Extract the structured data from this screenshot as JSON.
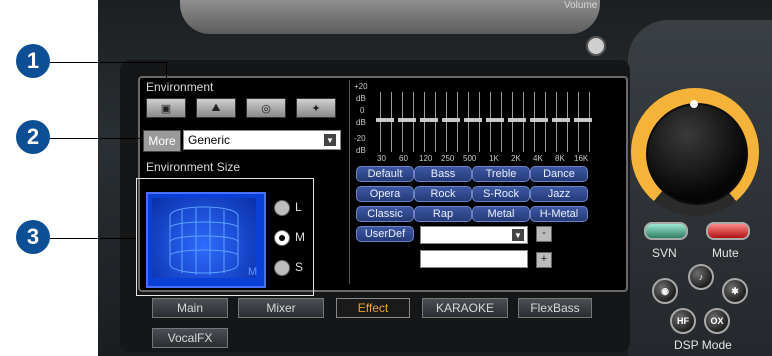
{
  "top": {
    "volume_label": "Volume"
  },
  "environment": {
    "title": "Environment",
    "buttons": [
      "stage-icon",
      "mountain-icon",
      "cave-icon",
      "hall-icon"
    ],
    "more_label": "More",
    "selected": "Generic"
  },
  "environment_size": {
    "title": "Environment Size",
    "options": [
      "L",
      "M",
      "S"
    ],
    "selected": "M",
    "badge": "M"
  },
  "equalizer": {
    "scale": [
      "+20",
      "dB",
      "0",
      "dB",
      "-20",
      "dB"
    ],
    "bands": [
      "30",
      "60",
      "120",
      "250",
      "500",
      "1K",
      "2K",
      "4K",
      "8K",
      "16K"
    ],
    "presets": [
      [
        "Default",
        "Bass",
        "Treble",
        "Dance"
      ],
      [
        "Opera",
        "Rock",
        "S-Rock",
        "Jazz"
      ],
      [
        "Classic",
        "Rap",
        "Metal",
        "H-Metal"
      ],
      [
        "UserDef"
      ]
    ],
    "minus": "-",
    "plus": "+"
  },
  "tabs": [
    "Main",
    "Mixer",
    "Effect",
    "KARAOKE",
    "FlexBass",
    "VocalFX"
  ],
  "active_tab": "Effect",
  "right": {
    "svn_label": "SVN",
    "mute_label": "Mute",
    "dsp_mode_label": "DSP Mode",
    "dsp_buttons": [
      "HF",
      "OX"
    ]
  },
  "callouts": [
    "1",
    "2",
    "3"
  ],
  "colors": {
    "accent": "#f2a12b",
    "preset_bg": "#2f4a94",
    "callout": "#0c4f95",
    "knob_ring": "#f5b33a"
  }
}
